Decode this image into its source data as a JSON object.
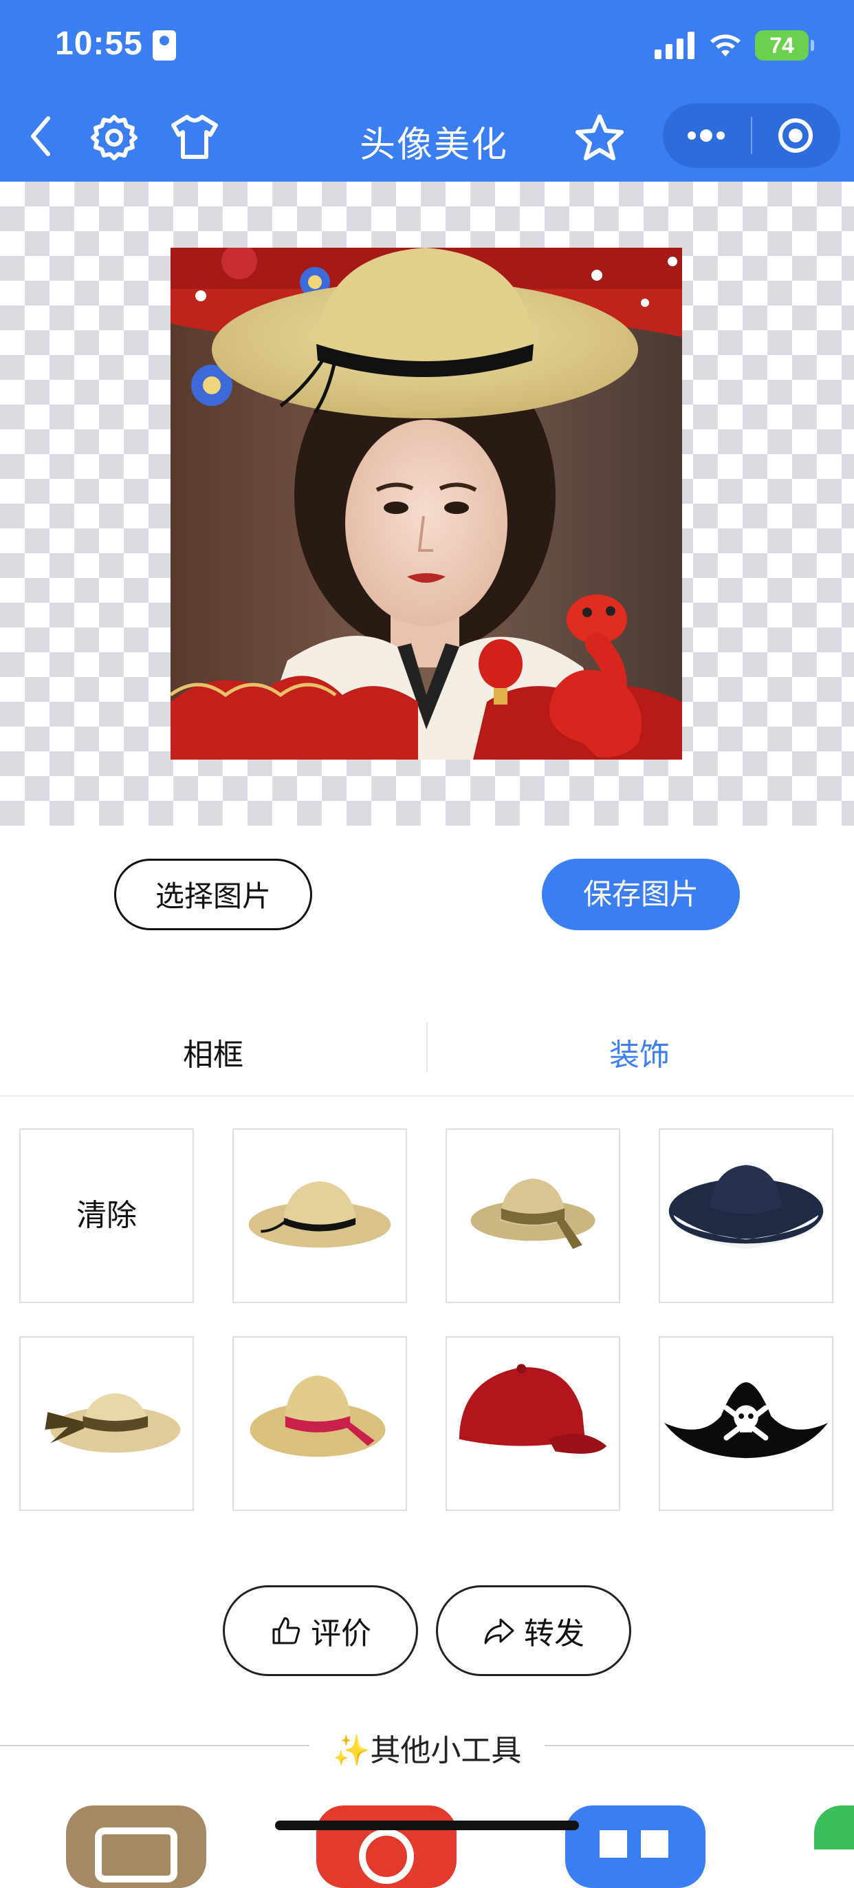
{
  "status_bar": {
    "time": "10:55",
    "battery": "74"
  },
  "nav": {
    "title": "头像美化"
  },
  "actions": {
    "choose_label": "选择图片",
    "save_label": "保存图片"
  },
  "tabs": [
    {
      "label": "相框"
    },
    {
      "label": "装饰"
    }
  ],
  "active_tab": 1,
  "decorations": {
    "clear_label": "清除",
    "items": [
      {
        "name": "straw-hat-black-band-icon"
      },
      {
        "name": "straw-hat-bow-icon"
      },
      {
        "name": "navy-white-sun-hat-icon"
      },
      {
        "name": "straw-boater-ribbon-icon"
      },
      {
        "name": "straw-hat-pink-band-icon"
      },
      {
        "name": "red-baseball-cap-icon"
      },
      {
        "name": "pirate-hat-icon"
      }
    ]
  },
  "footer_actions": {
    "rate_label": "评价",
    "share_label": "转发"
  },
  "other_tools": {
    "title": "✨其他小工具"
  },
  "colors": {
    "primary": "#3a7ef2",
    "battery": "#6bd04d"
  }
}
